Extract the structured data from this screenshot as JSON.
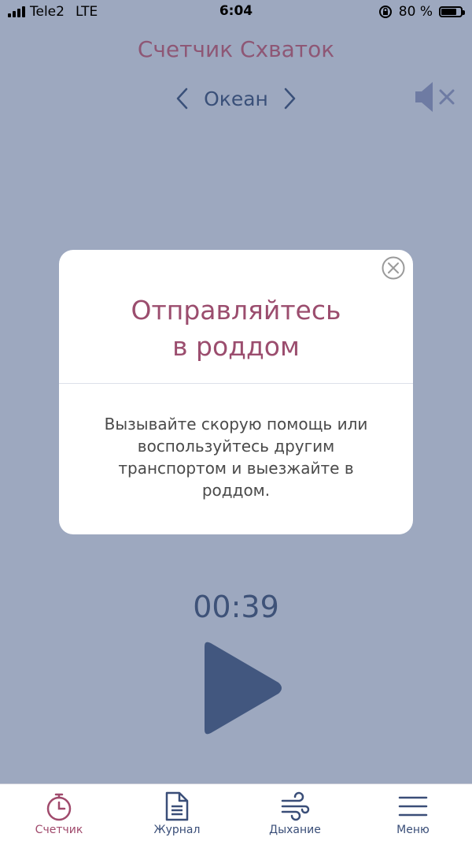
{
  "status_bar": {
    "carrier": "Tele2",
    "network": "LTE",
    "time": "6:04",
    "battery_text": "80 %",
    "battery_level": 0.8
  },
  "app": {
    "title": "Счетчик Схваток",
    "sound_name": "Океан",
    "timer": "00:39"
  },
  "modal": {
    "title_line1": "Отправляйтесь",
    "title_line2": "в роддом",
    "body": "Вызывайте скорую помощь или воспользуйтесь другим транспортом и выезжайте в роддом."
  },
  "tabs": [
    {
      "label": "Счетчик",
      "icon": "stopwatch-icon",
      "active": true
    },
    {
      "label": "Журнал",
      "icon": "document-icon",
      "active": false
    },
    {
      "label": "Дыхание",
      "icon": "wind-icon",
      "active": false
    },
    {
      "label": "Меню",
      "icon": "menu-icon",
      "active": false
    }
  ],
  "colors": {
    "background": "#9da8bf",
    "accent": "#9b4d6e",
    "primary": "#3a5079"
  }
}
